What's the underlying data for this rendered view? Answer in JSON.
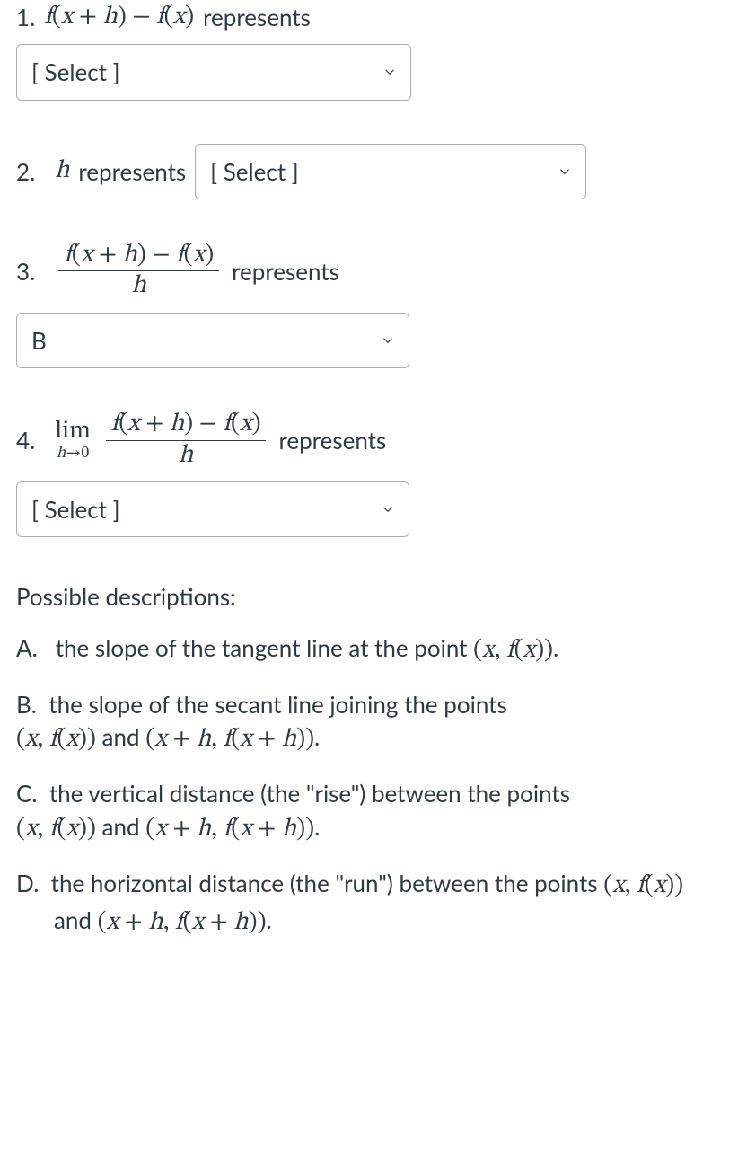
{
  "q1": {
    "num": "1.",
    "expr_fxh": "f",
    "expr_paren_open": "(",
    "expr_x": "x",
    "expr_plus": " + ",
    "expr_h": "h",
    "expr_paren_close": ")",
    "expr_minus": " − ",
    "expr_f2": "f",
    "expr_x2": "x",
    "tail": " represents",
    "select": "[ Select ]"
  },
  "q2": {
    "num": "2.",
    "h": "h",
    "tail": " represents",
    "select": "[ Select ]"
  },
  "q3": {
    "num": "3.",
    "num_f1": "f",
    "num_x1": "x",
    "num_plus": " + ",
    "num_h1": "h",
    "num_minus": " − ",
    "num_f2": "f",
    "num_x2": "x",
    "den_h": "h",
    "tail": " represents",
    "select": "B"
  },
  "q4": {
    "num": "4.",
    "lim": "lim",
    "lim_sub_h": "h",
    "lim_sub_arrow": "→0",
    "num_f1": "f",
    "num_x1": "x",
    "num_plus": " + ",
    "num_h1": "h",
    "num_minus": " − ",
    "num_f2": "f",
    "num_x2": "x",
    "den_h": "h",
    "tail": " represents",
    "select": "[ Select ]"
  },
  "descriptions": {
    "heading": "Possible descriptions:",
    "A": {
      "label": "A.",
      "text1": "the slope of the tangent line at the point ",
      "pt_x": "x",
      "pt_comma": ", ",
      "pt_f": "f",
      "pt_x2": "x",
      "period": "."
    },
    "B": {
      "label": "B.",
      "text1": "the slope of the secant line joining the points",
      "pt1_x": "x",
      "pt1_comma": ", ",
      "pt1_f": "f",
      "pt1_x2": "x",
      "and": " and ",
      "pt2_x": "x",
      "pt2_plus": " + ",
      "pt2_h": "h",
      "pt2_comma": ", ",
      "pt2_f": "f",
      "pt2_x2": "x",
      "pt2_plus2": " + ",
      "pt2_h2": "h",
      "period": "."
    },
    "C": {
      "label": "C.",
      "text1": "the vertical distance (the \"rise\") between the points",
      "pt1_x": "x",
      "pt1_comma": ", ",
      "pt1_f": "f",
      "pt1_x2": "x",
      "and": " and ",
      "pt2_x": "x",
      "pt2_plus": " + ",
      "pt2_h": "h",
      "pt2_comma": ", ",
      "pt2_f": "f",
      "pt2_x2": "x",
      "pt2_plus2": " + ",
      "pt2_h2": "h",
      "period": "."
    },
    "D": {
      "label": "D.",
      "text1": "the horizontal distance (the \"run\") between the points ",
      "pt1_x": "x",
      "pt1_comma": ", ",
      "pt1_f": "f",
      "pt1_x2": "x",
      "and": " and ",
      "pt2_x": "x",
      "pt2_plus": " + ",
      "pt2_h": "h",
      "pt2_comma": ", ",
      "pt2_f": "f",
      "pt2_x2": "x",
      "pt2_plus2": " + ",
      "pt2_h2": "h",
      "period": "."
    }
  }
}
